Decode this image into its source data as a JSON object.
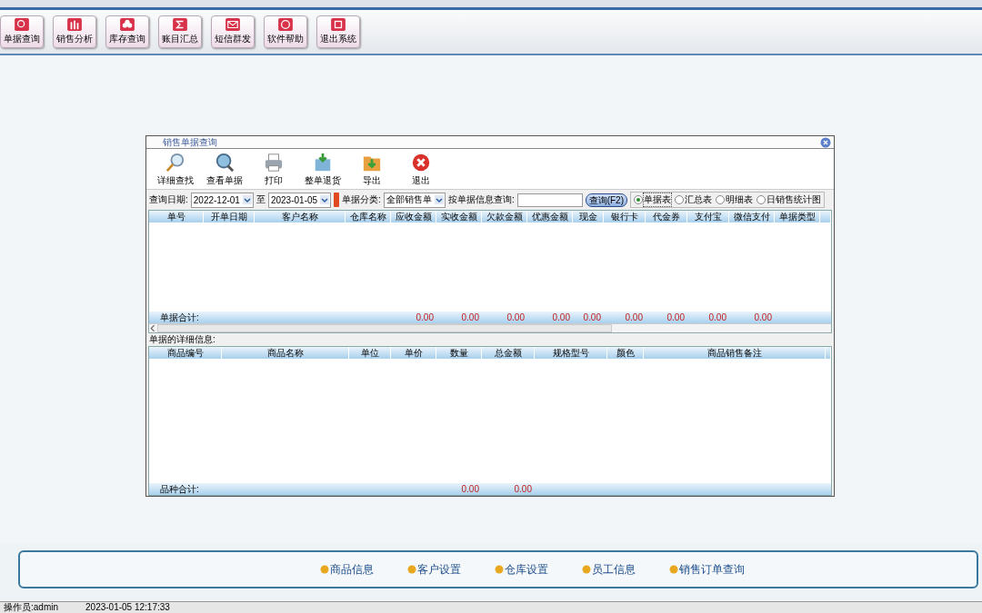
{
  "toolbar": [
    "单据查询",
    "销售分析",
    "库存查询",
    "账目汇总",
    "短信群发",
    "软件帮助",
    "退出系统"
  ],
  "dialog": {
    "title": "销售单据查询",
    "tools": [
      "详细查找",
      "查看单据",
      "打印",
      "整单退货",
      "导出",
      "退出"
    ],
    "filter": {
      "date_label": "查询日期:",
      "date_from": "2022-12-01",
      "to_label": "至",
      "date_to": "2023-01-05",
      "type_label": "单据分类:",
      "type_value": "全部销售单",
      "search_label": "按单据信息查询:",
      "search_button": "查询(F2)",
      "views": [
        {
          "label": "单据表",
          "selected": true
        },
        {
          "label": "汇总表",
          "selected": false
        },
        {
          "label": "明细表",
          "selected": false
        },
        {
          "label": "日销售统计图",
          "selected": false
        }
      ]
    },
    "orders": {
      "columns": [
        "单号",
        "开单日期",
        "客户名称",
        "仓库名称",
        "应收金额",
        "实收金额",
        "欠款金额",
        "优惠金额",
        "现金",
        "银行卡",
        "代金券",
        "支付宝",
        "微信支付",
        "单据类型"
      ],
      "total_label": "单据合计:",
      "totals": [
        "0.00",
        "0.00",
        "0.00",
        "0.00",
        "0.00",
        "0.00",
        "0.00",
        "0.00",
        "0.00"
      ]
    },
    "details_label": "单据的详细信息:",
    "details": {
      "columns": [
        "商品编号",
        "商品名称",
        "单位",
        "单价",
        "数量",
        "总金额",
        "规格型号",
        "颜色",
        "商品销售备注"
      ],
      "total_label": "品种合计:",
      "totals": [
        "0.00",
        "0.00"
      ]
    }
  },
  "quick_links": [
    "商品信息",
    "客户设置",
    "仓库设置",
    "员工信息",
    "销售订单查询"
  ],
  "status_bar": [
    "操作员:admin",
    "2023-01-05 12:17:33"
  ]
}
